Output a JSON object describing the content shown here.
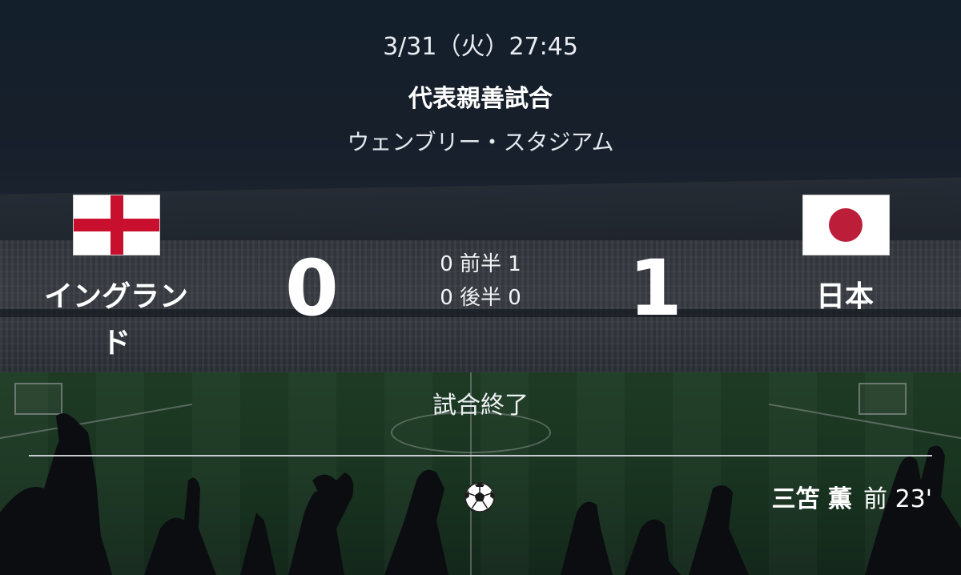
{
  "match": {
    "date": "3/31（火）27:45",
    "competition": "代表親善試合",
    "venue": "ウェンブリー・スタジアム",
    "status": "試合終了"
  },
  "home": {
    "name_line1": "イングラン",
    "name_line2": "ド",
    "score": "0",
    "flag_icon": "england-flag-icon"
  },
  "away": {
    "name": "日本",
    "score": "1",
    "flag_icon": "japan-flag-icon"
  },
  "halves": [
    "0 前半 1",
    "0 後半 0"
  ],
  "events": [
    {
      "type": "goal",
      "icon": "soccer-ball-icon",
      "player": "三笘 薫",
      "time": "前 23'"
    }
  ],
  "colors": {
    "england_red": "#c8102e",
    "japan_red": "#bc1e3a",
    "text": "#ffffff"
  }
}
